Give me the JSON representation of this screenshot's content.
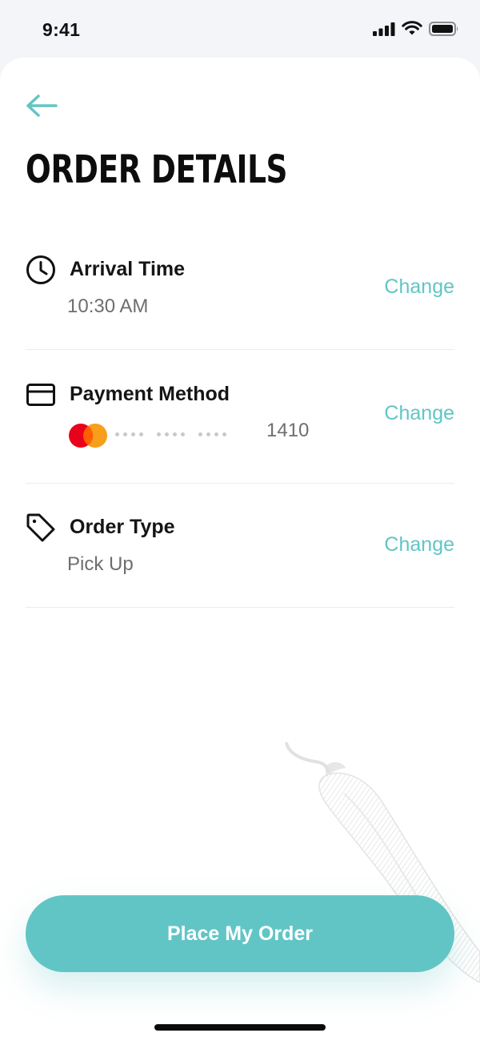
{
  "status_bar": {
    "time": "9:41",
    "icons": [
      "cellular-signal-icon",
      "wifi-icon",
      "battery-icon"
    ]
  },
  "header": {
    "back_icon": "arrow-left-icon",
    "title": "ORDER DETAILS"
  },
  "details": {
    "arrival": {
      "icon": "clock-icon",
      "label": "Arrival Time",
      "value": "10:30 AM",
      "change_label": "Change"
    },
    "payment": {
      "icon": "credit-card-icon",
      "label": "Payment Method",
      "card_brand_icon": "mastercard-icon",
      "card_last4": "1410",
      "change_label": "Change"
    },
    "order_type": {
      "icon": "tag-icon",
      "label": "Order Type",
      "value": "Pick Up",
      "change_label": "Change"
    }
  },
  "actions": {
    "place_order_label": "Place My Order"
  },
  "colors": {
    "accent": "#62c5c5",
    "mastercard_red": "#eb001b",
    "mastercard_orange": "#f79e1b"
  }
}
